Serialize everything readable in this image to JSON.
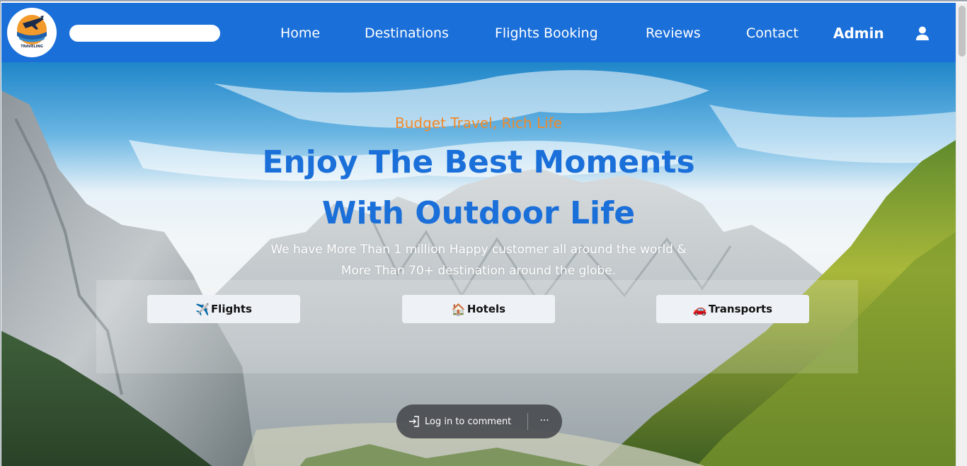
{
  "brand": {
    "logo_text": "TRAVELING"
  },
  "search": {
    "placeholder": "",
    "value": ""
  },
  "nav": {
    "home": "Home",
    "destinations": "Destinations",
    "flights_booking": "Flights Booking",
    "reviews": "Reviews",
    "contact": "Contact",
    "admin": "Admin",
    "user_icon": "user-icon"
  },
  "hero": {
    "tagline": "Budget Travel, Rich Life",
    "headline_line1": "Enjoy The Best Moments",
    "headline_line2": "With Outdoor Life",
    "subtext_line1": "We have More Than 1 million Happy customer all around the world &",
    "subtext_line2": "More Than 70+ destination around the globe."
  },
  "booking_tabs": [
    {
      "icon": "✈️",
      "label": "Flights"
    },
    {
      "icon": "🏠",
      "label": "Hotels"
    },
    {
      "icon": "🚗",
      "label": "Transports"
    }
  ],
  "comment_bar": {
    "login_label": "Log in to comment",
    "more_label": "···"
  },
  "colors": {
    "navbar": "#1a6fd9",
    "headline": "#1a6fd9",
    "tagline": "#f08a2a"
  }
}
